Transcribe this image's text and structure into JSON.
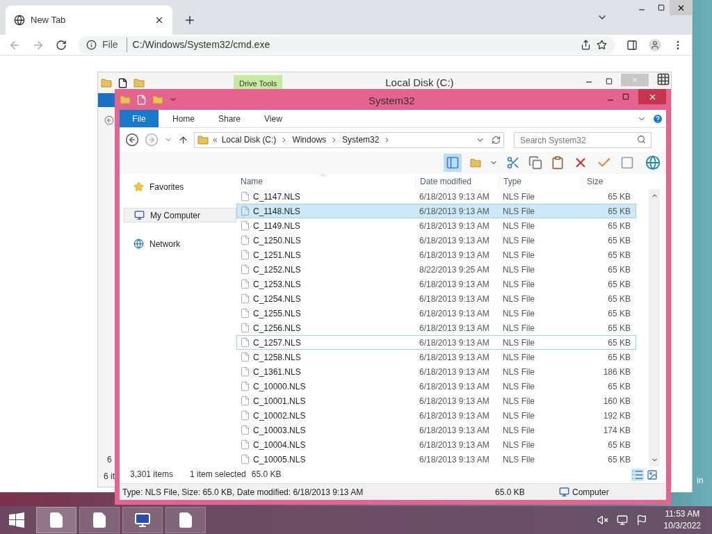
{
  "browser": {
    "tab_title": "New Tab",
    "scheme_label": "File",
    "url": "C:/Windows/System32/cmd.exe"
  },
  "back_window": {
    "title": "Local Disk (C:)",
    "contextual_tab": "Drive Tools",
    "list_fragment": "6",
    "status_fragment": "6 it"
  },
  "window": {
    "title": "System32",
    "ribbon_tabs": [
      {
        "label": "File",
        "kind": "file"
      },
      {
        "label": "Home",
        "kind": "tab"
      },
      {
        "label": "Share",
        "kind": "tab"
      },
      {
        "label": "View",
        "kind": "tab"
      }
    ],
    "overflow_mark": "«",
    "breadcrumbs": [
      "Local Disk (C:)",
      "Windows",
      "System32"
    ],
    "search": {
      "placeholder": "Search System32"
    },
    "sidebar": [
      {
        "label": "Favorites",
        "kind": "favorites",
        "selected": false
      },
      {
        "label": "My Computer",
        "kind": "computer",
        "selected": true
      },
      {
        "label": "Network",
        "kind": "network",
        "selected": false
      }
    ],
    "columns": [
      "Name",
      "Date modified",
      "Type",
      "Size"
    ],
    "rows": [
      {
        "name": "C_1147.NLS",
        "date": "6/18/2013 9:13 AM",
        "type": "NLS File",
        "size": "65 KB",
        "selected": false,
        "focused": false
      },
      {
        "name": "C_1148.NLS",
        "date": "6/18/2013 9:13 AM",
        "type": "NLS File",
        "size": "65 KB",
        "selected": true,
        "focused": false
      },
      {
        "name": "C_1149.NLS",
        "date": "6/18/2013 9:13 AM",
        "type": "NLS File",
        "size": "65 KB",
        "selected": false,
        "focused": false
      },
      {
        "name": "C_1250.NLS",
        "date": "6/18/2013 9:13 AM",
        "type": "NLS File",
        "size": "65 KB",
        "selected": false,
        "focused": false
      },
      {
        "name": "C_1251.NLS",
        "date": "6/18/2013 9:13 AM",
        "type": "NLS File",
        "size": "65 KB",
        "selected": false,
        "focused": false
      },
      {
        "name": "C_1252.NLS",
        "date": "8/22/2013 9:25 AM",
        "type": "NLS File",
        "size": "65 KB",
        "selected": false,
        "focused": false
      },
      {
        "name": "C_1253.NLS",
        "date": "6/18/2013 9:13 AM",
        "type": "NLS File",
        "size": "65 KB",
        "selected": false,
        "focused": false
      },
      {
        "name": "C_1254.NLS",
        "date": "6/18/2013 9:13 AM",
        "type": "NLS File",
        "size": "65 KB",
        "selected": false,
        "focused": false
      },
      {
        "name": "C_1255.NLS",
        "date": "6/18/2013 9:13 AM",
        "type": "NLS File",
        "size": "65 KB",
        "selected": false,
        "focused": false
      },
      {
        "name": "C_1256.NLS",
        "date": "6/18/2013 9:13 AM",
        "type": "NLS File",
        "size": "65 KB",
        "selected": false,
        "focused": false
      },
      {
        "name": "C_1257.NLS",
        "date": "6/18/2013 9:13 AM",
        "type": "NLS File",
        "size": "65 KB",
        "selected": false,
        "focused": true
      },
      {
        "name": "C_1258.NLS",
        "date": "6/18/2013 9:13 AM",
        "type": "NLS File",
        "size": "65 KB",
        "selected": false,
        "focused": false
      },
      {
        "name": "C_1361.NLS",
        "date": "6/18/2013 9:13 AM",
        "type": "NLS File",
        "size": "186 KB",
        "selected": false,
        "focused": false
      },
      {
        "name": "C_10000.NLS",
        "date": "6/18/2013 9:13 AM",
        "type": "NLS File",
        "size": "65 KB",
        "selected": false,
        "focused": false
      },
      {
        "name": "C_10001.NLS",
        "date": "6/18/2013 9:13 AM",
        "type": "NLS File",
        "size": "160 KB",
        "selected": false,
        "focused": false
      },
      {
        "name": "C_10002.NLS",
        "date": "6/18/2013 9:13 AM",
        "type": "NLS File",
        "size": "192 KB",
        "selected": false,
        "focused": false
      },
      {
        "name": "C_10003.NLS",
        "date": "6/18/2013 9:13 AM",
        "type": "NLS File",
        "size": "174 KB",
        "selected": false,
        "focused": false
      },
      {
        "name": "C_10004.NLS",
        "date": "6/18/2013 9:13 AM",
        "type": "NLS File",
        "size": "65 KB",
        "selected": false,
        "focused": false
      },
      {
        "name": "C_10005.NLS",
        "date": "6/18/2013 9:13 AM",
        "type": "NLS File",
        "size": "65 KB",
        "selected": false,
        "focused": false
      }
    ],
    "item_count": "3,301 items",
    "selection": "1 item selected",
    "selection_size": "65.0 KB",
    "status_bar": {
      "details": "Type: NLS File, Size: 65.0 KB, Date modified: 6/18/2013 9:13 AM",
      "size": "65.0 KB",
      "location": "Computer"
    }
  },
  "desktop_fragment": "in",
  "taskbar": {
    "time": "11:53 AM",
    "date": "10/3/2022"
  }
}
